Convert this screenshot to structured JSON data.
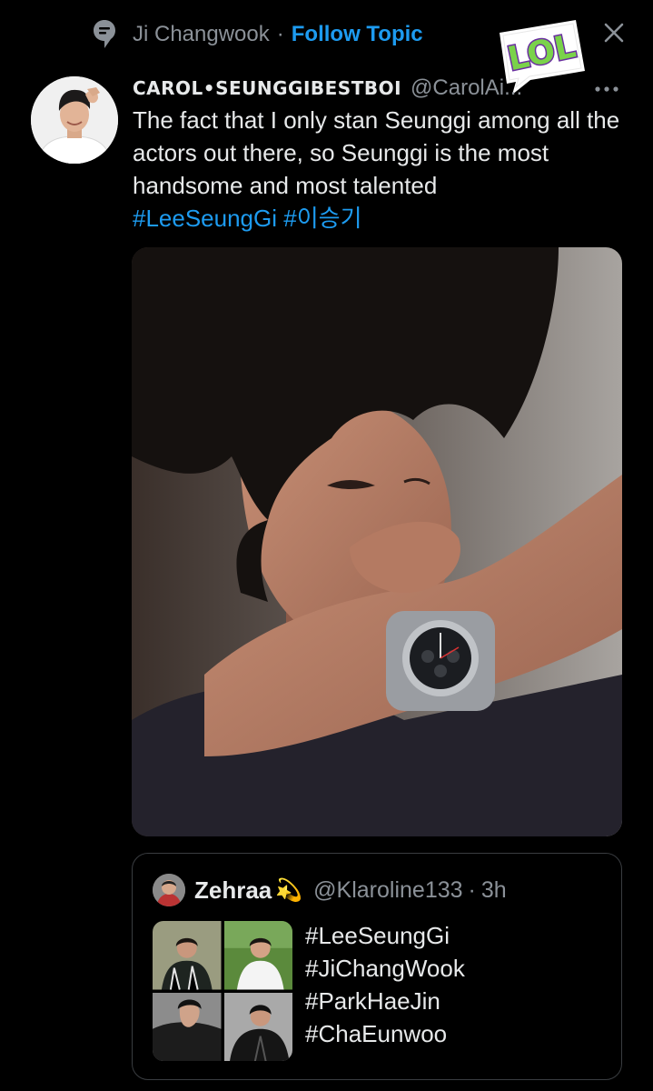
{
  "topic": {
    "name": "Ji Changwook",
    "separator": "·",
    "follow_label": "Follow Topic"
  },
  "sticker": {
    "text": "LOL"
  },
  "tweet": {
    "display_name": "CAROL•SEUNGGIBESTBOI",
    "handle": "@CarolAi...",
    "text": "The fact that I only stan Seunggi among all the actors out there, so Seunggi is the most handsome and most talented",
    "hashtags": [
      "#LeeSeungGi",
      "#이승기"
    ]
  },
  "quote": {
    "display_name": "Zehraa",
    "emoji": "💫",
    "handle": "@Klaroline133",
    "separator": "·",
    "time": "3h",
    "hashtags": [
      "#LeeSeungGi",
      "#JiChangWook",
      "#ParkHaeJin",
      "#ChaEunwoo"
    ]
  },
  "colors": {
    "background": "#000000",
    "link": "#1d9bf0",
    "secondary_text": "#8b9198",
    "sticker_green": "#7ad24a",
    "sticker_purple": "#6a2fa0"
  },
  "icons": [
    "topic-icon",
    "close-icon",
    "more-icon"
  ]
}
